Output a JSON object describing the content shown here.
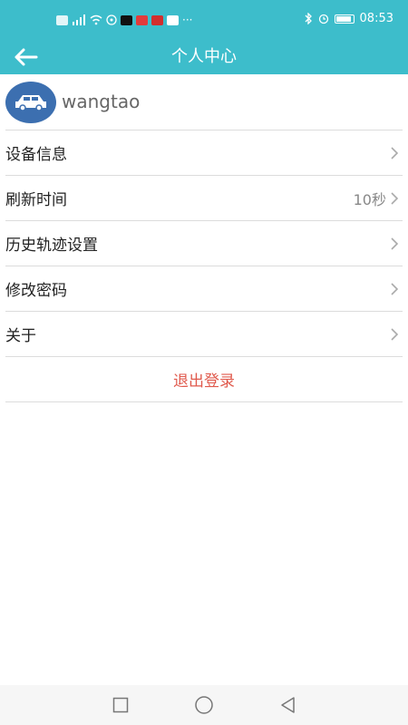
{
  "status_bar": {
    "time": "08:53",
    "left_icons": [
      "hd-icon",
      "signal-icon",
      "wifi-icon",
      "location-icon",
      "tiktok-icon",
      "app-icon",
      "app-icon",
      "play-icon",
      "more-dots-icon"
    ],
    "more": "···"
  },
  "header": {
    "title": "个人中心"
  },
  "profile": {
    "username": "wangtao"
  },
  "menu": [
    {
      "label": "设备信息",
      "value": ""
    },
    {
      "label": "刷新时间",
      "value": "10秒"
    },
    {
      "label": "历史轨迹设置",
      "value": ""
    },
    {
      "label": "修改密码",
      "value": ""
    },
    {
      "label": "关于",
      "value": ""
    }
  ],
  "logout_label": "退出登录",
  "colors": {
    "primary": "#3dbdcb",
    "logout": "#e05a4d",
    "avatar": "#3c6fb0"
  }
}
